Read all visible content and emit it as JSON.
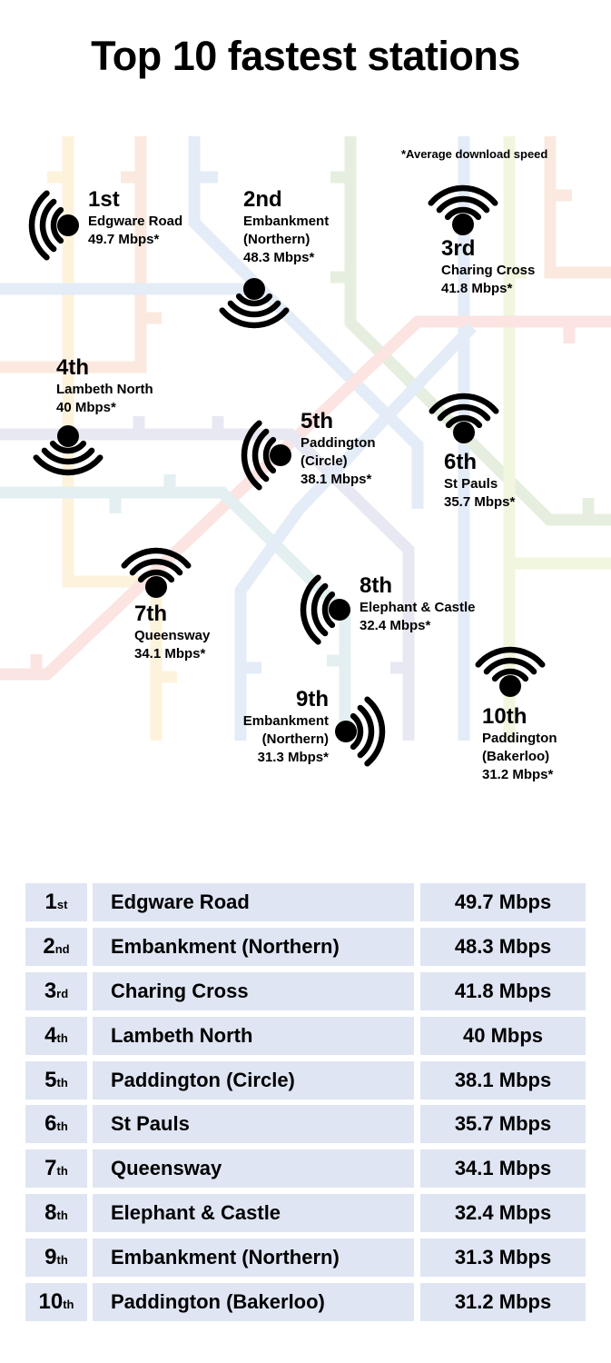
{
  "title": "Top 10 fastest stations",
  "footnote": "*Average download speed",
  "map_line_colors": {
    "yellow": "#fdf3dc",
    "orange": "#fbe9df",
    "blue": "#e3ecf7",
    "green": "#e6efdf",
    "lime": "#f1f6de",
    "red": "#fbe4e2",
    "purple": "#e8e8f3",
    "teal": "#e4eff2"
  },
  "stations": [
    {
      "rank": "1st",
      "lines": [
        "Edgware Road",
        "49.7 Mbps*"
      ],
      "icon": "wifi-left-icon"
    },
    {
      "rank": "2nd",
      "lines": [
        "Embankment",
        "(Northern)",
        "48.3 Mbps*"
      ],
      "icon": "wifi-down-icon"
    },
    {
      "rank": "3rd",
      "lines": [
        "Charing Cross",
        "41.8 Mbps*"
      ],
      "icon": "wifi-up-icon"
    },
    {
      "rank": "4th",
      "lines": [
        "Lambeth North",
        "40 Mbps*"
      ],
      "icon": "wifi-down-icon"
    },
    {
      "rank": "5th",
      "lines": [
        "Paddington",
        "(Circle)",
        "38.1 Mbps*"
      ],
      "icon": "wifi-left-icon"
    },
    {
      "rank": "6th",
      "lines": [
        "St Pauls",
        "35.7 Mbps*"
      ],
      "icon": "wifi-up-icon"
    },
    {
      "rank": "7th",
      "lines": [
        "Queensway",
        "34.1 Mbps*"
      ],
      "icon": "wifi-up-icon"
    },
    {
      "rank": "8th",
      "lines": [
        "Elephant & Castle",
        "32.4 Mbps*"
      ],
      "icon": "wifi-left-icon"
    },
    {
      "rank": "9th",
      "lines": [
        "Embankment",
        "(Northern)",
        "31.3 Mbps*"
      ],
      "icon": "wifi-right-icon"
    },
    {
      "rank": "10th",
      "lines": [
        "Paddington",
        "(Bakerloo)",
        "31.2 Mbps*"
      ],
      "icon": "wifi-up-icon"
    }
  ],
  "table": {
    "cell_color": "#dfe5f3",
    "rows": [
      {
        "num": "1",
        "suffix": "st",
        "name": "Edgware Road",
        "speed": "49.7 Mbps"
      },
      {
        "num": "2",
        "suffix": "nd",
        "name": "Embankment (Northern)",
        "speed": "48.3 Mbps"
      },
      {
        "num": "3",
        "suffix": "rd",
        "name": "Charing Cross",
        "speed": "41.8 Mbps"
      },
      {
        "num": "4",
        "suffix": "th",
        "name": "Lambeth North",
        "speed": "40 Mbps"
      },
      {
        "num": "5",
        "suffix": "th",
        "name": "Paddington (Circle)",
        "speed": "38.1 Mbps"
      },
      {
        "num": "6",
        "suffix": "th",
        "name": "St Pauls",
        "speed": "35.7 Mbps"
      },
      {
        "num": "7",
        "suffix": "th",
        "name": "Queensway",
        "speed": "34.1 Mbps"
      },
      {
        "num": "8",
        "suffix": "th",
        "name": "Elephant & Castle",
        "speed": "32.4 Mbps"
      },
      {
        "num": "9",
        "suffix": "th",
        "name": "Embankment (Northern)",
        "speed": "31.3 Mbps"
      },
      {
        "num": "10",
        "suffix": "th",
        "name": "Paddington (Bakerloo)",
        "speed": "31.2 Mbps"
      }
    ]
  }
}
